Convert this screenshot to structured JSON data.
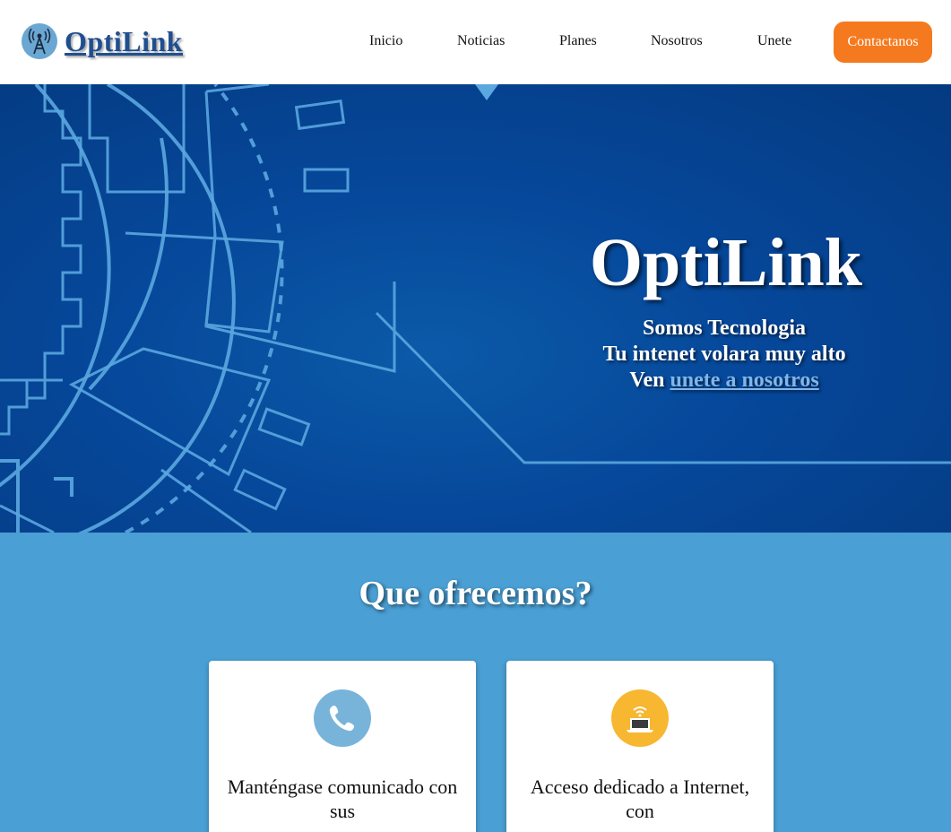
{
  "brand": {
    "name": "OptiLink",
    "logo_icon": "antenna-icon"
  },
  "nav": {
    "items": [
      {
        "label": "Inicio"
      },
      {
        "label": "Noticias"
      },
      {
        "label": "Planes"
      },
      {
        "label": "Nosotros"
      },
      {
        "label": "Unete"
      }
    ],
    "cta_label": "Contactanos"
  },
  "hero": {
    "title": "OptiLink",
    "line1": "Somos Tecnologia",
    "line2": "Tu intenet volara muy alto",
    "line3_prefix": "Ven",
    "link_text": "unete a nosotros"
  },
  "offer": {
    "title": "Que ofrecemos?",
    "cards": [
      {
        "icon": "phone-icon",
        "icon_color": "#78b4da",
        "text": "Manténgase comunicado con sus"
      },
      {
        "icon": "wifi-laptop-icon",
        "icon_color": "#f7b731",
        "text": "Acceso dedicado a Internet, con"
      }
    ]
  },
  "colors": {
    "accent": "#f57a1f",
    "brand": "#1f4f8f",
    "hero_bg": "#06479a",
    "offer_bg": "#4a9fd4"
  }
}
